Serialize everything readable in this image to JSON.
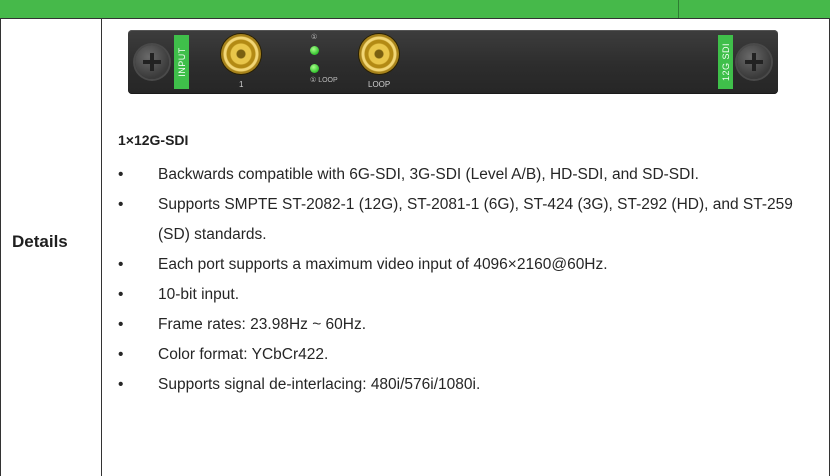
{
  "card": {
    "input_label": "INPUT",
    "output_label": "12G SDI",
    "port1_label": "1",
    "loop_port_label": "LOOP",
    "led1_label": "①",
    "led2_label": "① LOOP"
  },
  "row_label": "Details",
  "heading": "1×12G-SDI",
  "bullets": [
    "Backwards compatible with 6G-SDI, 3G-SDI (Level A/B), HD-SDI, and SD-SDI.",
    "Supports SMPTE ST-2082-1 (12G), ST-2081-1 (6G), ST-424 (3G), ST-292 (HD), and ST-259 (SD) standards.",
    "Each port supports a maximum video input of 4096×2160@60Hz.",
    "10-bit input.",
    "Frame rates: 23.98Hz ~ 60Hz.",
    "Color format: YCbCr422.",
    "Supports signal de-interlacing: 480i/576i/1080i."
  ],
  "colors": {
    "header_green": "#46b94a",
    "tag_green": "#3fbf4a",
    "connector_gold": "#e9c64a"
  },
  "icons": [
    "screw-icon",
    "bnc-connector-icon",
    "led-indicator-icon"
  ]
}
